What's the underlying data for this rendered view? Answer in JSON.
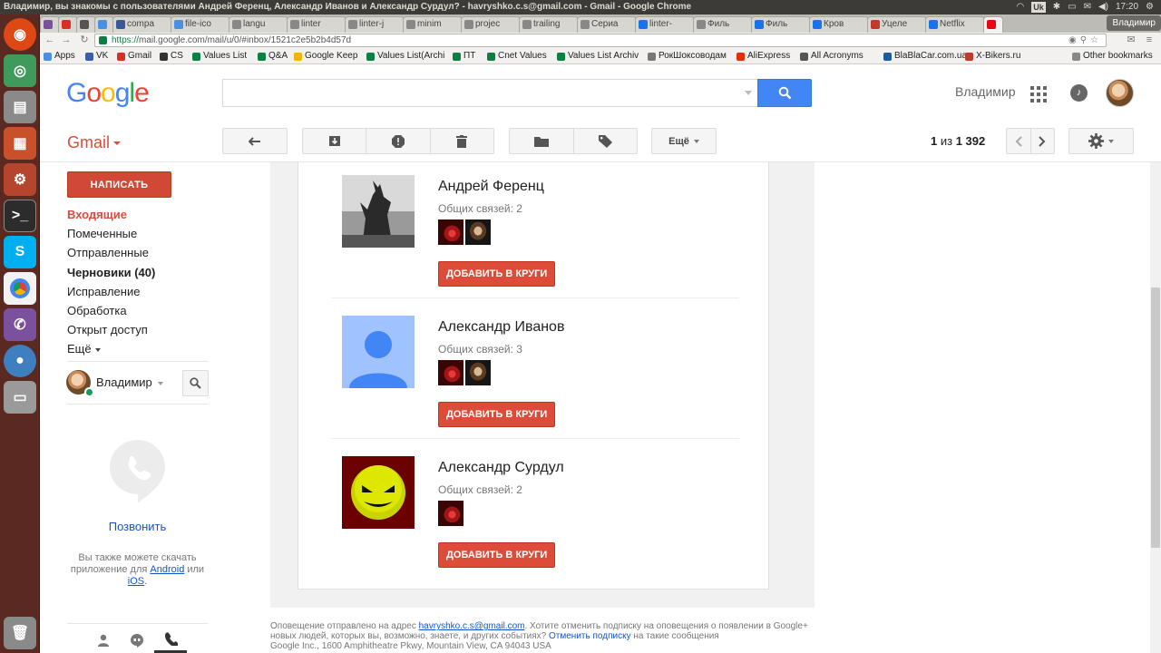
{
  "os": {
    "window_title": "Владимир, вы знакомы с пользователями Андрей Ференц, Александр Иванов и Александр Сурдул? - havryshko.c.s@gmail.com - Gmail - Google Chrome",
    "keyboard_layout": "Uk",
    "time": "17:20"
  },
  "browser": {
    "tabs": [
      "",
      "",
      "",
      "",
      "compa",
      "file-ico",
      "langu",
      "linter",
      "linter-j",
      "minim",
      "projec",
      "trailing",
      "Сериа",
      "linter-",
      "Филь",
      "Филь",
      "Кров",
      "Уцеле",
      "Netflix",
      ""
    ],
    "profile_name": "Владимир",
    "url_scheme": "https://",
    "url_rest": "mail.google.com/mail/u/0/#inbox/1521c2e5b2b4d57d",
    "bookmarks": [
      "Apps",
      "VK",
      "Gmail",
      "CS",
      "Values List",
      "Q&A",
      "Google Keep",
      "Values List(Archi",
      "ПТ",
      "Cnet Values",
      "Values List Archiv",
      "РокШоксоводам",
      "AliExpress",
      "All Acronyms",
      "BlaBlaCar.com.ua",
      "X-Bikers.ru"
    ],
    "other_bookmarks": "Other bookmarks"
  },
  "header": {
    "logo": "Google",
    "user_name": "Владимир"
  },
  "toolbar": {
    "brand": "Gmail",
    "more_label": "Ещё",
    "pager_prefix": "1",
    "pager_mid": " из ",
    "pager_total": "1 392"
  },
  "sidebar": {
    "compose": "НАПИСАТЬ",
    "items": [
      "Входящие",
      "Помеченные",
      "Отправленные",
      "Черновики (40)",
      "Исправление",
      "Обработка",
      "Открыт доступ",
      "Ещё"
    ],
    "hangouts_name": "Владимир",
    "call_label": "Позвонить",
    "download_note_pre": "Вы также можете скачать приложение для ",
    "download_android": "Android",
    "download_or": " или ",
    "download_ios": "iOS",
    "download_end": "."
  },
  "people": [
    {
      "name": "Андрей Ференц",
      "mutual": "Общих связей: 2",
      "button": "ДОБАВИТЬ В КРУГИ"
    },
    {
      "name": "Александр Иванов",
      "mutual": "Общих связей: 3",
      "button": "ДОБАВИТЬ В КРУГИ"
    },
    {
      "name": "Александр Сурдул",
      "mutual": "Общих связей: 2",
      "button": "ДОБАВИТЬ В КРУГИ"
    }
  ],
  "footer": {
    "line1_pre": "Оповещение отправлено на адрес ",
    "email": "havryshko.c.s@gmail.com",
    "line1_post": ". Хотите отменить подписку на оповещения о появлении в Google+ новых людей, которых вы, возможно, знаете, и других событиях? ",
    "unsubscribe": "Отменить подписку",
    "line2_post": " на такие сообщения",
    "address": "Google Inc., 1600 Amphitheatre Pkwy, Mountain View, CA 94043 USA"
  },
  "colors": {
    "gmail_red": "#dd4b39",
    "search_blue": "#4285f4",
    "link_blue": "#1155cc",
    "launcher": "#5a2a22"
  }
}
